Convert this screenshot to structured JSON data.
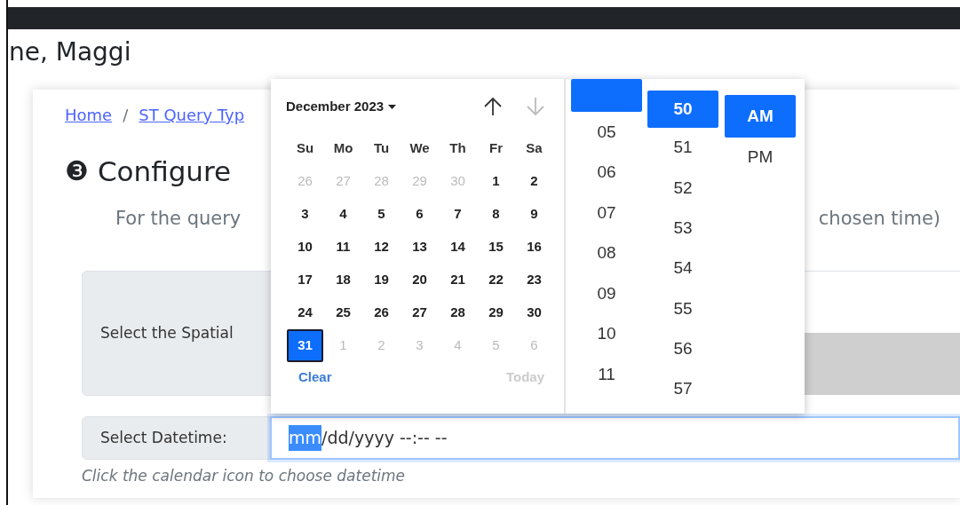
{
  "greeting": "ne, Maggi",
  "breadcrumb": [
    "Home",
    "ST Query Typ"
  ],
  "breadcrumb_separator": "/",
  "step": {
    "number": "❸",
    "title": "Configure"
  },
  "instruction_parts": [
    "For the query",
    "chosen time)"
  ],
  "spatial": {
    "label": "Select the Spatial"
  },
  "datetime": {
    "label": "Select Datetime:",
    "segments": [
      {
        "text": "mm",
        "selected": true
      },
      {
        "text": "/dd/yyyy --:-- --",
        "selected": false
      }
    ]
  },
  "hint": "Click the calendar icon to choose datetime",
  "picker": {
    "month": "December 2023",
    "prev_disabled": false,
    "next_disabled": true,
    "weekdays": [
      "Su",
      "Mo",
      "Tu",
      "We",
      "Th",
      "Fr",
      "Sa"
    ],
    "weeks": [
      [
        {
          "d": "26",
          "other": true,
          "selected": false
        },
        {
          "d": "27",
          "other": true,
          "selected": false
        },
        {
          "d": "28",
          "other": true,
          "selected": false
        },
        {
          "d": "29",
          "other": true,
          "selected": false
        },
        {
          "d": "30",
          "other": true,
          "selected": false
        },
        {
          "d": "1",
          "other": false,
          "selected": false
        },
        {
          "d": "2",
          "other": false,
          "selected": false
        }
      ],
      [
        {
          "d": "3",
          "other": false,
          "selected": false
        },
        {
          "d": "4",
          "other": false,
          "selected": false
        },
        {
          "d": "5",
          "other": false,
          "selected": false
        },
        {
          "d": "6",
          "other": false,
          "selected": false
        },
        {
          "d": "7",
          "other": false,
          "selected": false
        },
        {
          "d": "8",
          "other": false,
          "selected": false
        },
        {
          "d": "9",
          "other": false,
          "selected": false
        }
      ],
      [
        {
          "d": "10",
          "other": false,
          "selected": false
        },
        {
          "d": "11",
          "other": false,
          "selected": false
        },
        {
          "d": "12",
          "other": false,
          "selected": false
        },
        {
          "d": "13",
          "other": false,
          "selected": false
        },
        {
          "d": "14",
          "other": false,
          "selected": false
        },
        {
          "d": "15",
          "other": false,
          "selected": false
        },
        {
          "d": "16",
          "other": false,
          "selected": false
        }
      ],
      [
        {
          "d": "17",
          "other": false,
          "selected": false
        },
        {
          "d": "18",
          "other": false,
          "selected": false
        },
        {
          "d": "19",
          "other": false,
          "selected": false
        },
        {
          "d": "20",
          "other": false,
          "selected": false
        },
        {
          "d": "21",
          "other": false,
          "selected": false
        },
        {
          "d": "22",
          "other": false,
          "selected": false
        },
        {
          "d": "23",
          "other": false,
          "selected": false
        }
      ],
      [
        {
          "d": "24",
          "other": false,
          "selected": false
        },
        {
          "d": "25",
          "other": false,
          "selected": false
        },
        {
          "d": "26",
          "other": false,
          "selected": false
        },
        {
          "d": "27",
          "other": false,
          "selected": false
        },
        {
          "d": "28",
          "other": false,
          "selected": false
        },
        {
          "d": "29",
          "other": false,
          "selected": false
        },
        {
          "d": "30",
          "other": false,
          "selected": false
        }
      ],
      [
        {
          "d": "31",
          "other": false,
          "selected": true
        },
        {
          "d": "1",
          "other": true,
          "selected": false
        },
        {
          "d": "2",
          "other": true,
          "selected": false
        },
        {
          "d": "3",
          "other": true,
          "selected": false
        },
        {
          "d": "4",
          "other": true,
          "selected": false
        },
        {
          "d": "5",
          "other": true,
          "selected": false
        },
        {
          "d": "6",
          "other": true,
          "selected": false
        }
      ]
    ],
    "clear": "Clear",
    "today": "Today",
    "today_disabled": true,
    "hours": [
      {
        "selected": true
      },
      {
        "text": "05",
        "selected": false
      },
      {
        "text": "06",
        "selected": false
      },
      {
        "text": "07",
        "selected": false
      },
      {
        "text": "08",
        "selected": false
      },
      {
        "text": "09",
        "selected": false
      },
      {
        "text": "10",
        "selected": false
      },
      {
        "text": "11",
        "selected": false
      }
    ],
    "minutes": [
      {
        "text": "50",
        "selected": true
      },
      {
        "text": "51",
        "selected": false
      },
      {
        "text": "52",
        "selected": false
      },
      {
        "text": "53",
        "selected": false
      },
      {
        "text": "54",
        "selected": false
      },
      {
        "text": "55",
        "selected": false
      },
      {
        "text": "56",
        "selected": false
      },
      {
        "text": "57",
        "selected": false
      }
    ],
    "meridiem": [
      {
        "text": "AM",
        "selected": true
      },
      {
        "text": "PM",
        "selected": false
      }
    ]
  }
}
